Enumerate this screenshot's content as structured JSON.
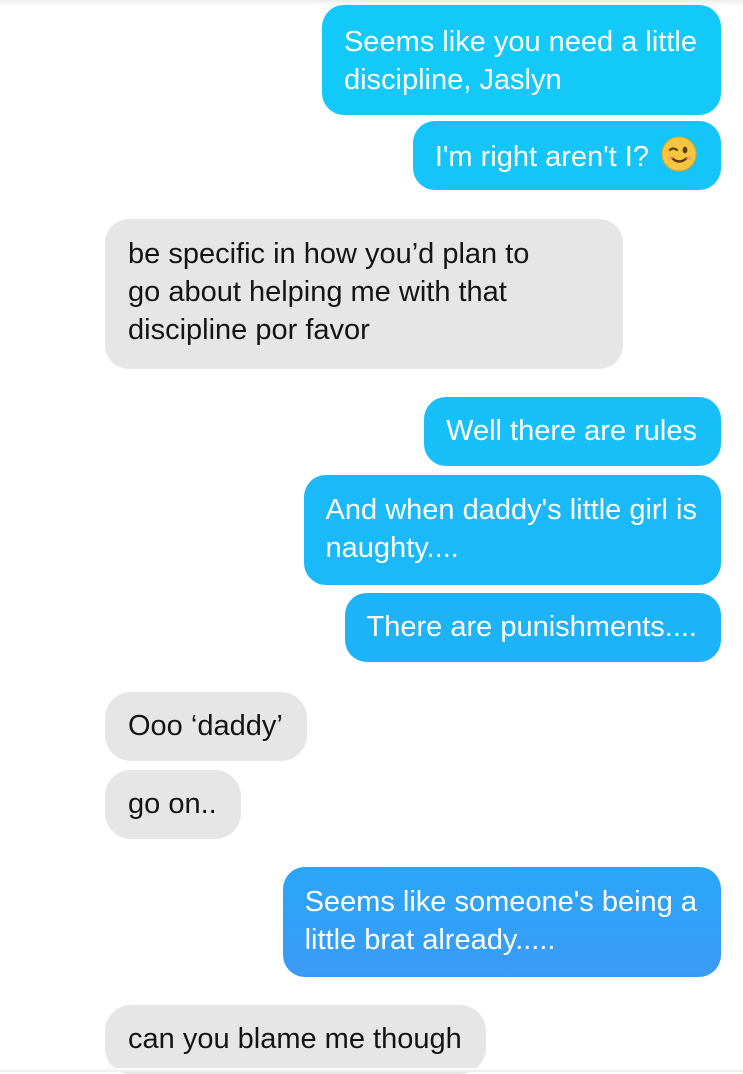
{
  "conversation": {
    "messages": [
      {
        "from": "me",
        "lines": [
          "Seems like you need a little",
          "discipline, Jaslyn"
        ]
      },
      {
        "from": "me",
        "lines": [
          "I'm right aren't I?"
        ],
        "emoji": "winking-face-icon"
      },
      {
        "from": "them",
        "lines": [
          "be specific in how you’d plan to",
          "go about helping me with that",
          "discipline por favor"
        ]
      },
      {
        "from": "me",
        "lines": [
          "Well there are rules"
        ]
      },
      {
        "from": "me",
        "lines": [
          "And when daddy's little girl is",
          "naughty...."
        ]
      },
      {
        "from": "me",
        "lines": [
          "There are punishments...."
        ]
      },
      {
        "from": "them",
        "lines": [
          "Ooo ‘daddy’"
        ]
      },
      {
        "from": "them",
        "lines": [
          "go on.."
        ]
      },
      {
        "from": "me",
        "lines": [
          "Seems like someone's being a",
          "little brat already....."
        ]
      },
      {
        "from": "them",
        "lines": [
          "can you blame me though"
        ]
      }
    ]
  },
  "colors": {
    "sent_bubble_top": "#12c9fa",
    "sent_bubble_bottom": "#3a9bf7",
    "received_bubble": "#e6e6e6",
    "received_text": "#141414",
    "sent_text": "#ffffff"
  }
}
